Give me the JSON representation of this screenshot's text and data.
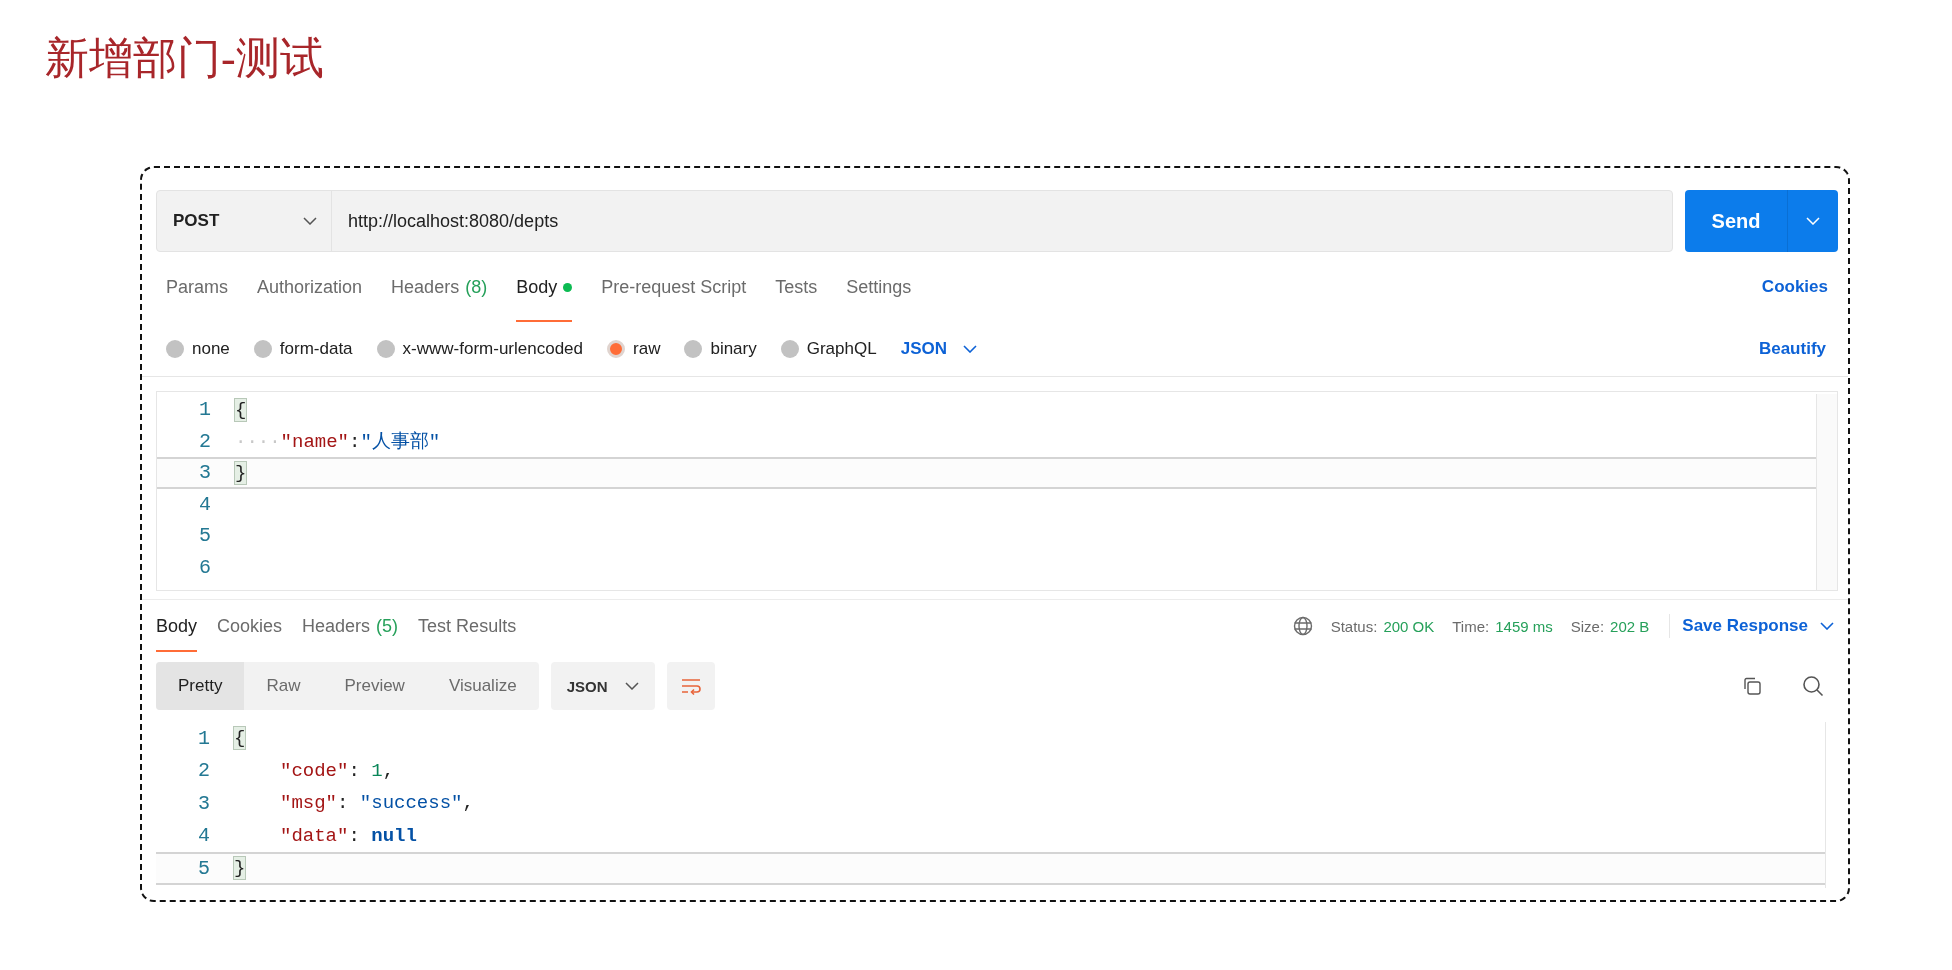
{
  "slide_title": "新增部门-测试",
  "request": {
    "method": "POST",
    "url": "http://localhost:8080/depts",
    "send": "Send"
  },
  "request_tabs": [
    {
      "label": "Params",
      "selected": false,
      "has_dot": false
    },
    {
      "label": "Authorization",
      "selected": false,
      "has_dot": false
    },
    {
      "label": "Headers",
      "count": "(8)",
      "selected": false,
      "has_dot": false
    },
    {
      "label": "Body",
      "selected": true,
      "has_dot": true
    },
    {
      "label": "Pre-request Script",
      "selected": false,
      "has_dot": false
    },
    {
      "label": "Tests",
      "selected": false,
      "has_dot": false
    },
    {
      "label": "Settings",
      "selected": false,
      "has_dot": false
    }
  ],
  "cookies_link": "Cookies",
  "body_types": [
    {
      "label": "none",
      "selected": false
    },
    {
      "label": "form-data",
      "selected": false
    },
    {
      "label": "x-www-form-urlencoded",
      "selected": false
    },
    {
      "label": "raw",
      "selected": true
    },
    {
      "label": "binary",
      "selected": false
    },
    {
      "label": "GraphQL",
      "selected": false
    }
  ],
  "body_format": "JSON",
  "beautify": "Beautify",
  "request_lines": [
    {
      "number": "1",
      "active": false,
      "tokens": [
        {
          "kind": "brace",
          "text": "{",
          "matched": true
        }
      ]
    },
    {
      "number": "2",
      "active": false,
      "tokens": [
        {
          "kind": "whitespace",
          "text": "····"
        },
        {
          "kind": "key",
          "text": "\"name\""
        },
        {
          "kind": "punct",
          "text": ":"
        },
        {
          "kind": "string",
          "text": "\"人事部\""
        }
      ]
    },
    {
      "number": "3",
      "active": true,
      "tokens": [
        {
          "kind": "brace",
          "text": "}",
          "matched": true
        }
      ]
    },
    {
      "number": "4",
      "active": false
    },
    {
      "number": "5",
      "active": false
    },
    {
      "number": "6",
      "active": false
    }
  ],
  "response_tabs": [
    {
      "label": "Body",
      "selected": true
    },
    {
      "label": "Cookies",
      "selected": false
    },
    {
      "label": "Headers",
      "count": "(5)",
      "selected": false
    },
    {
      "label": "Test Results",
      "selected": false
    }
  ],
  "response_meta": [
    {
      "label": "Status:",
      "value": "200 OK"
    },
    {
      "label": "Time:",
      "value": "1459 ms"
    },
    {
      "label": "Size:",
      "value": "202 B"
    }
  ],
  "save_response": "Save Response",
  "view_modes": [
    {
      "label": "Pretty",
      "selected": true
    },
    {
      "label": "Raw",
      "selected": false
    },
    {
      "label": "Preview",
      "selected": false
    },
    {
      "label": "Visualize",
      "selected": false
    }
  ],
  "response_format": "JSON",
  "response_lines": [
    {
      "number": "1",
      "active": false,
      "indented": false,
      "tokens": [
        {
          "kind": "brace",
          "text": "{",
          "matched": true
        }
      ]
    },
    {
      "number": "2",
      "active": false,
      "indented": true,
      "tokens": [
        {
          "kind": "key",
          "text": "\"code\""
        },
        {
          "kind": "punct",
          "text": ": "
        },
        {
          "kind": "number",
          "text": "1"
        },
        {
          "kind": "punct",
          "text": ","
        }
      ]
    },
    {
      "number": "3",
      "active": false,
      "indented": true,
      "tokens": [
        {
          "kind": "key",
          "text": "\"msg\""
        },
        {
          "kind": "punct",
          "text": ": "
        },
        {
          "kind": "string",
          "text": "\"success\""
        },
        {
          "kind": "punct",
          "text": ","
        }
      ]
    },
    {
      "number": "4",
      "active": false,
      "indented": true,
      "tokens": [
        {
          "kind": "key",
          "text": "\"data\""
        },
        {
          "kind": "punct",
          "text": ": "
        },
        {
          "kind": "keyword",
          "text": "null"
        }
      ]
    },
    {
      "number": "5",
      "active": true,
      "indented": false,
      "tokens": [
        {
          "kind": "brace",
          "text": "}",
          "matched": true
        }
      ]
    }
  ]
}
